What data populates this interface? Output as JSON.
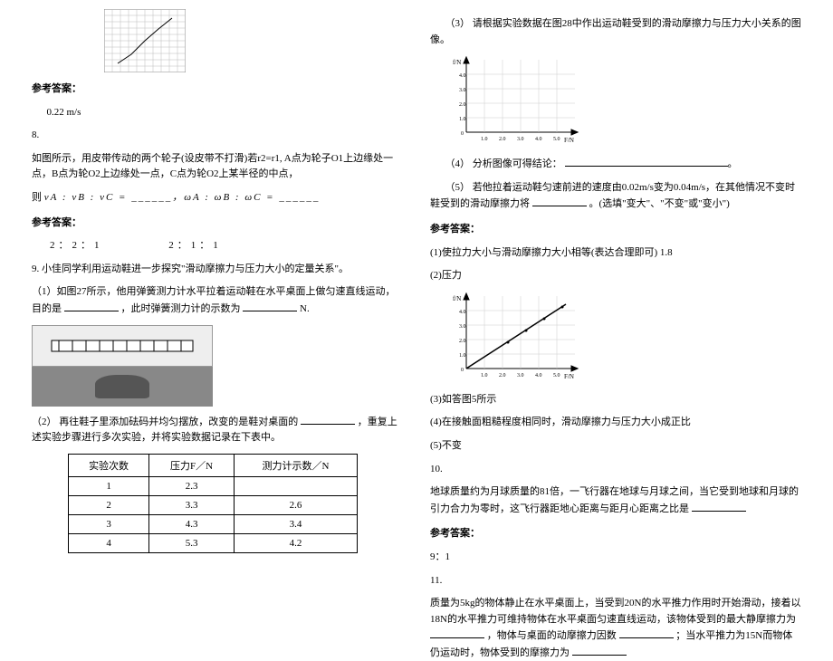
{
  "left": {
    "answer_label": "参考答案：",
    "a7_answer": "0.22 m/s",
    "q8_num": "8.",
    "q8_text": "如图所示，用皮带传动的两个轮子(设皮带不打滑)若r2=r1, A点为轮子O1上边缘处一点，B点为轮O2上边缘处一点，C点为轮O2上某半径的中点，",
    "q8_formula_prefix": "则",
    "q8_formula": "νA : νB : νC = ______，ωA : ωB : ωC = ______",
    "answer_label2": "参考答案：",
    "q8_ans1": "2：2：1",
    "q8_ans2": "2：1：1",
    "q9_text": "9. 小佳同学利用运动鞋进一步探究\"滑动摩擦力与压力大小的定量关系\"。",
    "q9_p1": "（1）如图27所示，他用弹簧测力计水平拉着运动鞋在水平桌面上做匀速直线运动，目的是",
    "q9_p1_tail": "，此时弹簧测力计的示数为",
    "q9_p1_unit": "N.",
    "q9_p2": "（2） 再往鞋子里添加砝码并均匀摆放，改变的是鞋对桌面的",
    "q9_p2_tail": "，重复上述实验步骤进行多次实验，并将实验数据记录在下表中。",
    "table": {
      "h1": "实验次数",
      "h2": "压力F／N",
      "h3": "测力计示数／N",
      "rows": [
        {
          "n": "1",
          "f": "2.3",
          "r": ""
        },
        {
          "n": "2",
          "f": "3.3",
          "r": "2.6"
        },
        {
          "n": "3",
          "f": "4.3",
          "r": "3.4"
        },
        {
          "n": "4",
          "f": "5.3",
          "r": "4.2"
        }
      ]
    }
  },
  "right": {
    "q9_p3": "（3） 请根据实验数据在图28中作出运动鞋受到的滑动摩擦力与压力大小关系的图像。",
    "q9_p4": "（4） 分析图像可得结论：",
    "q9_p5": "（5） 若他拉着运动鞋匀速前进的速度由0.02m/s变为0.04m/s，在其他情况不变时鞋受到的滑动摩擦力将",
    "q9_p5_tail": "。(选填\"变大\"、\"不变\"或\"变小\")",
    "answer_label": "参考答案：",
    "a1": "(1)使拉力大小与滑动摩擦力大小相等(表达合理即可)  1.8",
    "a2": "(2)压力",
    "a3": "(3)如答图5所示",
    "a4": "(4)在接触面粗糙程度相同时，滑动摩擦力与压力大小成正比",
    "a5": "(5)不变",
    "q10_num": "10.",
    "q10_text": "地球质量约为月球质量的81倍，一飞行器在地球与月球之间，当它受到地球和月球的引力合力为零时，这飞行器距地心距离与距月心距离之比是",
    "answer_label2": "参考答案：",
    "q10_ans": "9：1",
    "q11_num": "11.",
    "q11_text": "质量为5kg的物体静止在水平桌面上，当受到20N的水平推力作用时开始滑动，接着以18N的水平推力可维持物体在水平桌面匀速直线运动，该物体受到的最大静摩擦力为",
    "q11_text2": "，物体与桌面的动摩擦力因数",
    "q11_text3": "；当水平推力为15N而物体仍运动时，物体受到的摩擦力为"
  },
  "chart_data": [
    {
      "type": "line",
      "id": "fig28-blank",
      "title": "",
      "xlabel": "F/N",
      "ylabel": "f/N",
      "xlim": [
        0,
        6
      ],
      "ylim": [
        0,
        5
      ],
      "x_ticks": [
        0,
        1,
        2,
        3,
        4,
        5,
        6
      ],
      "y_ticks": [
        0,
        1,
        2,
        3,
        4,
        5
      ],
      "series": []
    },
    {
      "type": "line",
      "id": "fig5-answer",
      "title": "",
      "xlabel": "F/N",
      "ylabel": "f/N",
      "xlim": [
        0,
        6
      ],
      "ylim": [
        0,
        5
      ],
      "x_ticks": [
        0,
        1,
        2,
        3,
        4,
        5,
        6
      ],
      "y_ticks": [
        0,
        1,
        2,
        3,
        4,
        5
      ],
      "series": [
        {
          "name": "f",
          "x": [
            2.3,
            3.3,
            4.3,
            5.3
          ],
          "y": [
            1.8,
            2.6,
            3.4,
            4.2
          ]
        }
      ]
    }
  ]
}
